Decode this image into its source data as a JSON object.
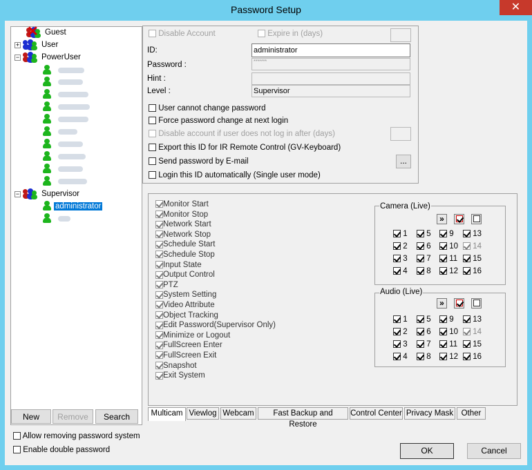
{
  "window": {
    "title": "Password Setup",
    "close_glyph": "✕"
  },
  "tree": {
    "nodes": [
      {
        "label": "Guest"
      },
      {
        "label": "User"
      },
      {
        "label": "PowerUser"
      },
      {
        "label": "Supervisor"
      },
      {
        "label": "administrator"
      }
    ]
  },
  "account": {
    "disable_account": "Disable Account",
    "expire_in": "Expire in (days)",
    "expire_value": "",
    "id_label": "ID:",
    "id_value": "administrator",
    "password_label": "Password :",
    "password_value": "*******",
    "hint_label": "Hint :",
    "hint_value": "",
    "level_label": "Level :",
    "level_value": "Supervisor"
  },
  "options": {
    "cannot_change": "User cannot change password",
    "force_change": "Force password change at next login",
    "disable_if_not_login": "Disable account if user does not log in after (days)",
    "disable_days_value": "",
    "export_ir": "Export this ID for IR Remote Control (GV-Keyboard)",
    "send_email": "Send password by E-mail",
    "send_email_btn": "...",
    "login_auto": "Login this ID automatically (Single user mode)"
  },
  "permissions": [
    "Monitor Start",
    "Monitor Stop",
    "Network Start",
    "Network Stop",
    "Schedule Start",
    "Schedule Stop",
    "Input State",
    "Output Control",
    "PTZ",
    "System Setting",
    "Video Attribute",
    "Object Tracking",
    "Edit Password(Supervisor Only)",
    "Minimize or Logout",
    "FullScreen Enter",
    "FullScreen Exit",
    "Snapshot",
    "Exit System"
  ],
  "camera": {
    "title": "Camera (Live)",
    "numbers": [
      "1",
      "2",
      "3",
      "4",
      "5",
      "6",
      "7",
      "8",
      "9",
      "10",
      "11",
      "12",
      "13",
      "14",
      "15",
      "16"
    ]
  },
  "audio": {
    "title": "Audio (Live)",
    "numbers": [
      "1",
      "2",
      "3",
      "4",
      "5",
      "6",
      "7",
      "8",
      "9",
      "10",
      "11",
      "12",
      "13",
      "14",
      "15",
      "16"
    ]
  },
  "icons": {
    "forward": "»",
    "check_all": "check-all-icon",
    "clear_all": "clear-all-icon"
  },
  "tabs": [
    "Multicam",
    "Viewlog",
    "Webcam",
    "Fast Backup and Restore",
    "Control Center",
    "Privacy Mask",
    "Other"
  ],
  "buttons": {
    "new": "New",
    "remove": "Remove",
    "search": "Search",
    "ok": "OK",
    "cancel": "Cancel"
  },
  "bottom": {
    "allow_removing": "Allow removing password system",
    "enable_double": "Enable double password"
  }
}
